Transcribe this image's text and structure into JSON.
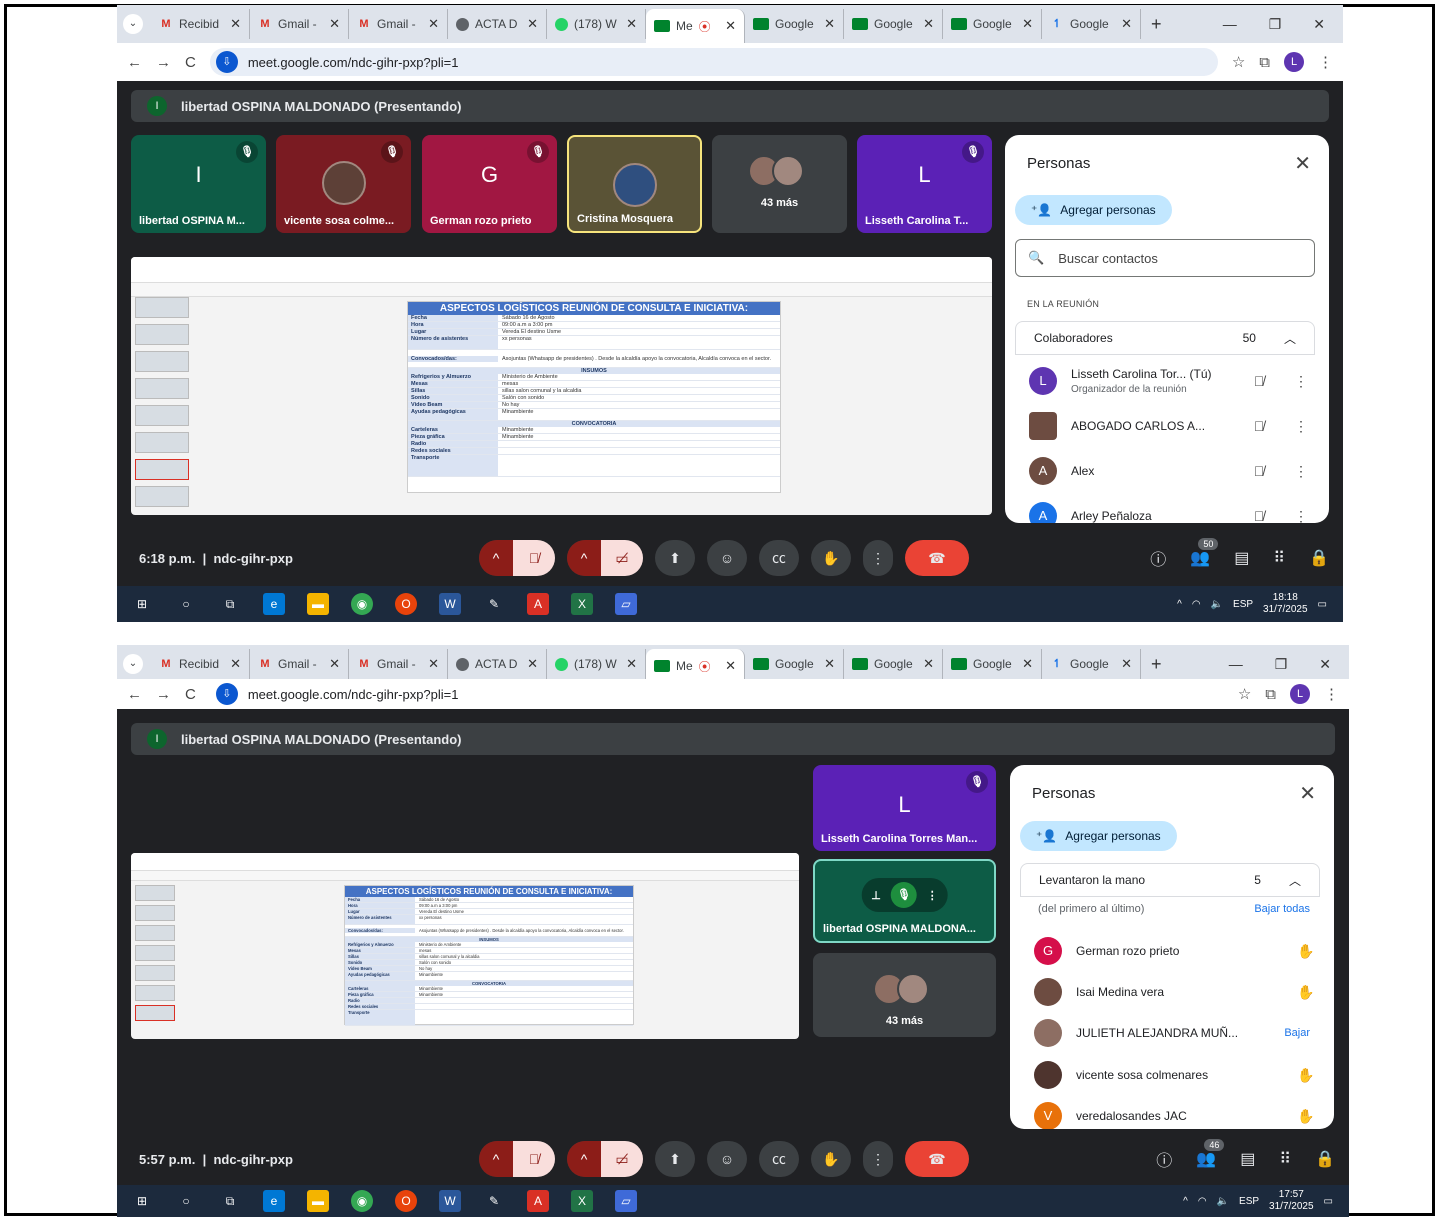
{
  "tabs": [
    {
      "label": "Recibid",
      "icon": "gmail-icon"
    },
    {
      "label": "Gmail -",
      "icon": "gmail-icon"
    },
    {
      "label": "Gmail -",
      "icon": "gmail-icon"
    },
    {
      "label": "ACTA D",
      "icon": "web-icon"
    },
    {
      "label": "(178) W",
      "icon": "whatsapp-icon"
    },
    {
      "label": "Me",
      "icon": "meet-icon",
      "active": true
    },
    {
      "label": "Google",
      "icon": "meet-icon"
    },
    {
      "label": "Google",
      "icon": "meet-icon"
    },
    {
      "label": "Google",
      "icon": "meet-icon"
    },
    {
      "label": "Google",
      "icon": "google-icon"
    }
  ],
  "address": {
    "url": "meet.google.com/ndc-gihr-pxp?pli=1",
    "profile_initial": "L"
  },
  "presenting": {
    "badge": "I",
    "label": "libertad OSPINA MALDONADO (Presentando)"
  },
  "slide": {
    "title": "ASPECTOS LOGÍSTICOS REUNIÓN DE CONSULTA E INICIATIVA:",
    "rows": [
      {
        "k": "Fecha",
        "v": "Sábado 16 de Agosto"
      },
      {
        "k": "Hora",
        "v": "09:00 a.m a 3:00 pm"
      },
      {
        "k": "Lugar",
        "v": "Vereda El destino Usme"
      },
      {
        "k": "Número de asistentes",
        "v": "xx personas"
      },
      {
        "k": "Convocados/das:",
        "v": "Asojuntas (Whatsapp de presidentes) . Desde la alcaldía apoyo la convocatoria, Alcaldía convoca en el sector."
      }
    ],
    "section1": "INSUMOS",
    "rows2": [
      {
        "k": "Refrigerios y Almuerzo",
        "v": "Ministerio de Ambiente"
      },
      {
        "k": "Mesas",
        "v": "mesas"
      },
      {
        "k": "Sillas",
        "v": "sillas salon comunal y la alcaldia"
      },
      {
        "k": "Sonido",
        "v": "Salón con sonido"
      },
      {
        "k": "Video Beam",
        "v": "No hay"
      },
      {
        "k": "Ayudas pedagógicas",
        "v": "Minambiente"
      }
    ],
    "section2": "CONVOCATORIA",
    "rows3": [
      {
        "k": "Carteleras",
        "v": "Minambiente"
      },
      {
        "k": "Pieza gráfica",
        "v": "Minambiente"
      },
      {
        "k": "Radio",
        "v": ""
      },
      {
        "k": "Redes sociales",
        "v": ""
      },
      {
        "k": "Transporte",
        "v": ""
      }
    ]
  },
  "shot1": {
    "tiles": [
      {
        "name": "libertad OSPINA M...",
        "initial": "I",
        "color": "#0d5c46"
      },
      {
        "name": "vicente sosa colme...",
        "initial": "",
        "color": "#7a1b22"
      },
      {
        "name": "German rozo prieto",
        "initial": "G",
        "color": "#a11742"
      },
      {
        "name": "Cristina Mosquera",
        "initial": "",
        "color": "#5a5336"
      },
      {
        "name": "43 más",
        "initial": "",
        "color": "#3c4043"
      },
      {
        "name": "Lisseth Carolina T...",
        "initial": "L",
        "color": "#5b21b6"
      }
    ],
    "panel": {
      "title": "Personas",
      "add_label": "Agregar personas",
      "search_placeholder": "Buscar contactos",
      "section": "EN LA REUNIÓN",
      "group_label": "Colaboradores",
      "group_count": "50",
      "people": [
        {
          "name": "Lisseth Carolina Tor... (Tú)",
          "sub": "Organizador de la reunión",
          "initial": "L",
          "color": "#5e35b1"
        },
        {
          "name": "ABOGADO CARLOS A...",
          "sub": "",
          "initial": "",
          "color": "#6d4c41"
        },
        {
          "name": "Alex",
          "sub": "",
          "initial": "A",
          "color": "#6d4c41"
        },
        {
          "name": "Arley Peñaloza",
          "sub": "",
          "initial": "A",
          "color": "#1a73e8"
        }
      ]
    },
    "time": "6:18 p.m.",
    "code": "ndc-gihr-pxp",
    "people_badge": "50",
    "clock_time": "18:18",
    "clock_date": "31/7/2025"
  },
  "shot2": {
    "tiles": [
      {
        "name": "Lisseth Carolina Torres Man...",
        "initial": "L",
        "color": "#5b21b6"
      },
      {
        "name": "libertad OSPINA MALDONA...",
        "initial": "",
        "color": "#0d5c46"
      },
      {
        "name": "43 más",
        "initial": "",
        "color": "#3c4043"
      }
    ],
    "panel": {
      "title": "Personas",
      "add_label": "Agregar personas",
      "group_label": "Levantaron la mano",
      "group_count": "5",
      "order_note": "(del primero al último)",
      "lower_all": "Bajar todas",
      "people": [
        {
          "name": "German rozo prieto",
          "initial": "G",
          "color": "#d50f4a",
          "lower": ""
        },
        {
          "name": "Isai Medina vera",
          "initial": "",
          "color": "#6d4c41",
          "lower": ""
        },
        {
          "name": "JULIETH ALEJANDRA MUÑ...",
          "initial": "",
          "color": "#8d6e63",
          "lower": "Bajar"
        },
        {
          "name": "vicente sosa colmenares",
          "initial": "",
          "color": "#4e342e",
          "lower": ""
        },
        {
          "name": "veredalosandes JAC",
          "initial": "V",
          "color": "#e8710a",
          "lower": ""
        }
      ]
    },
    "time": "5:57 p.m.",
    "code": "ndc-gihr-pxp",
    "people_badge": "46",
    "clock_time": "17:57",
    "clock_date": "31/7/2025"
  },
  "tray_lang": "ESP",
  "separator": "|"
}
